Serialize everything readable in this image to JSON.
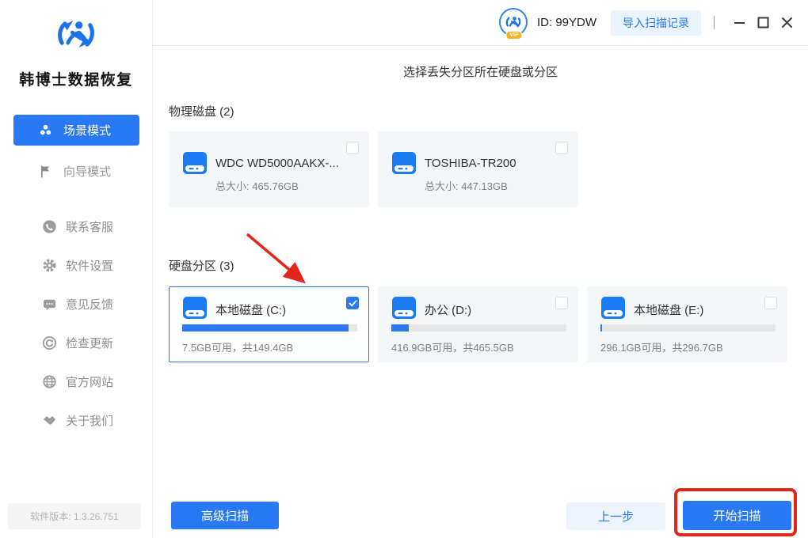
{
  "app": {
    "name": "韩博士数据恢复",
    "version": "软件版本: 1.3.26.751"
  },
  "header": {
    "user_id": "ID: 99YDW",
    "vip_badge": "VIP",
    "import_scan_button": "导入扫描记录"
  },
  "sidebar": {
    "modes": [
      {
        "label": "场景模式",
        "active": true
      },
      {
        "label": "向导模式",
        "active": false
      }
    ],
    "menu": [
      {
        "label": "联系客服",
        "icon": "phone-circle-icon"
      },
      {
        "label": "软件设置",
        "icon": "gear-icon"
      },
      {
        "label": "意见反馈",
        "icon": "feedback-comment-icon"
      },
      {
        "label": "检查更新",
        "icon": "check-update-icon"
      },
      {
        "label": "官方网站",
        "icon": "globe-icon"
      },
      {
        "label": "关于我们",
        "icon": "handshake-icon"
      }
    ]
  },
  "main": {
    "title": "选择丢失分区所在硬盘或分区",
    "physical_disks": {
      "label": "物理磁盘 (2)",
      "cards": [
        {
          "name": "WDC WD5000AAKX-...",
          "size": "总大小: 465.76GB",
          "checked": false
        },
        {
          "name": "TOSHIBA-TR200",
          "size": "总大小: 447.13GB",
          "checked": false
        }
      ]
    },
    "partitions": {
      "label": "硬盘分区 (3)",
      "cards": [
        {
          "name": "本地磁盘 (C:)",
          "size": "7.5GB可用，共149.4GB",
          "checked": true,
          "used_percent": 95
        },
        {
          "name": "办公 (D:)",
          "size": "416.9GB可用，共465.5GB",
          "checked": false,
          "used_percent": 10
        },
        {
          "name": "本地磁盘 (E:)",
          "size": "296.1GB可用，共296.7GB",
          "checked": false,
          "used_percent": 1
        }
      ]
    },
    "footer": {
      "advanced_scan": "高级扫描",
      "prev_step": "上一步",
      "start_scan": "开始扫描"
    }
  },
  "colors": {
    "primary": "#2879f3",
    "primary_light_bg": "#ebf3fe",
    "card_bg": "#f4f7fa",
    "progress_track": "#e7e7e7",
    "annotation_red": "#e2261c"
  }
}
